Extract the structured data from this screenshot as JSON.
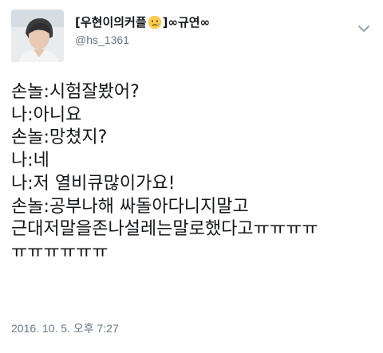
{
  "tweet": {
    "author": {
      "display_name_prefix": "[우현이의커플",
      "display_name_emoji": "crying-face-emoji",
      "display_name_suffix": "]∞규연∞",
      "handle": "@hs_1361",
      "avatar": "profile-photo"
    },
    "menu_icon": "chevron-down-icon",
    "lines": [
      "손놀:시험잘봤어?",
      "나:아니요",
      "손놀:망쳤지?",
      "나:네",
      "나:저 열비큐많이가요!",
      "손놀:공부나해 싸돌아다니지말고",
      "근대저말을존나설레는말로했다고ㅠㅠㅠㅠ",
      "ㅠㅠㅠㅠㅠㅠ"
    ],
    "timestamp": "2016. 10. 5. 오후 7:27"
  },
  "colors": {
    "text": "#14171a",
    "secondary": "#657786",
    "background": "#ffffff"
  }
}
